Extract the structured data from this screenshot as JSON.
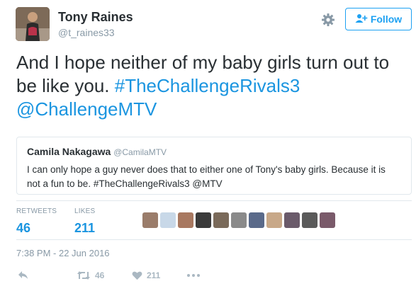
{
  "user": {
    "name": "Tony Raines",
    "handle": "@t_raines33"
  },
  "header": {
    "follow_label": "Follow"
  },
  "tweet": {
    "text_plain": "And I hope neither of my baby girls turn out to be like you. ",
    "hashtag": "#TheChallengeRivals3",
    "mention": "@ChallengeMTV"
  },
  "quote": {
    "name": "Camila Nakagawa",
    "handle": "@CamilaMTV",
    "text": "I can only hope a guy never does that to either one of Tony's baby girls. Because it is not a fun to be. #TheChallengeRivals3 @MTV"
  },
  "stats": {
    "retweets_label": "RETWEETS",
    "retweets_value": "46",
    "likes_label": "LIKES",
    "likes_value": "211"
  },
  "likers": [
    {
      "color": "#9a7c6a"
    },
    {
      "color": "#c8d8e8"
    },
    {
      "color": "#a87860"
    },
    {
      "color": "#3a3a3a"
    },
    {
      "color": "#7a6a5a"
    },
    {
      "color": "#8a8a8a"
    },
    {
      "color": "#5a6a8a"
    },
    {
      "color": "#c8a888"
    },
    {
      "color": "#6a5a6a"
    },
    {
      "color": "#5a5a5a"
    },
    {
      "color": "#7a5a6a"
    }
  ],
  "timestamp": "7:38 PM - 22 Jun 2016",
  "actions": {
    "retweet_count": "46",
    "like_count": "211"
  },
  "colors": {
    "link": "#1b95e0",
    "muted": "#8899a6",
    "icon": "#aab8c2"
  },
  "icons": [
    "gear-icon",
    "follow-user-icon",
    "reply-icon",
    "retweet-icon",
    "heart-icon",
    "more-icon"
  ]
}
